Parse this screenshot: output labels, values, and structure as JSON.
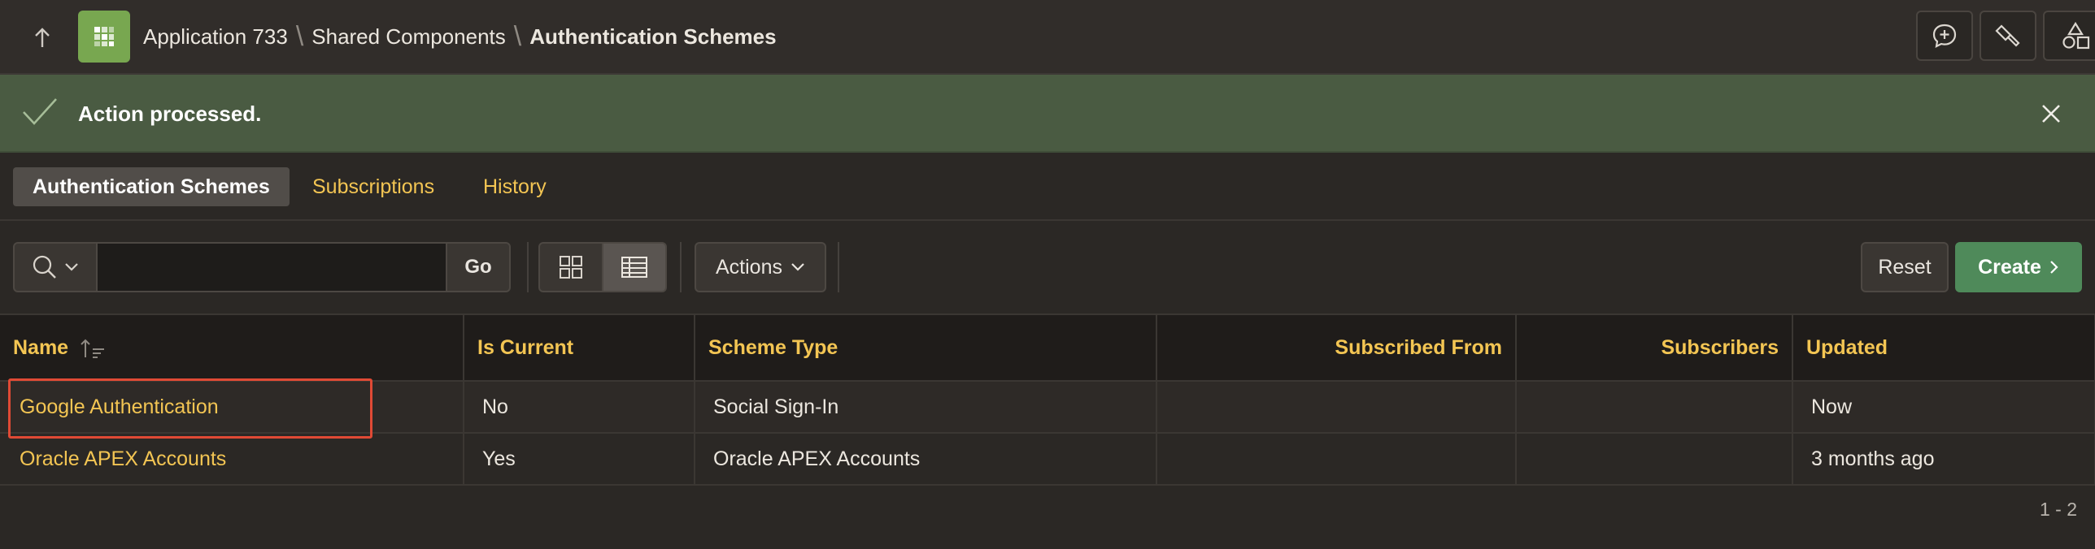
{
  "header": {
    "breadcrumb": [
      "Application 733",
      "Shared Components",
      "Authentication Schemes"
    ],
    "app_icon_color": "#78a750",
    "tools": [
      "feedback-icon",
      "highlighter-icon",
      "shapes-icon"
    ]
  },
  "message": {
    "text": "Action processed.",
    "type": "success"
  },
  "tabs": [
    {
      "label": "Authentication Schemes",
      "active": true
    },
    {
      "label": "Subscriptions",
      "active": false
    },
    {
      "label": "History",
      "active": false
    }
  ],
  "toolbar": {
    "search_value": "",
    "go_label": "Go",
    "actions_label": "Actions",
    "reset_label": "Reset",
    "create_label": "Create"
  },
  "table": {
    "columns": [
      "Name",
      "Is Current",
      "Scheme Type",
      "Subscribed From",
      "Subscribers",
      "Updated"
    ],
    "rows": [
      {
        "name": "Google Authentication",
        "is_current": "No",
        "scheme_type": "Social Sign-In",
        "subscribed_from": "",
        "subscribers": "",
        "updated": "Now"
      },
      {
        "name": "Oracle APEX Accounts",
        "is_current": "Yes",
        "scheme_type": "Oracle APEX Accounts",
        "subscribed_from": "",
        "subscribers": "",
        "updated": "3 months ago"
      }
    ]
  },
  "pagination": "1 - 2",
  "colors": {
    "accent_link": "#f3c553",
    "success_bg": "#4a5b42",
    "create_bg": "#4f8a5a",
    "highlight": "#e04a35"
  }
}
